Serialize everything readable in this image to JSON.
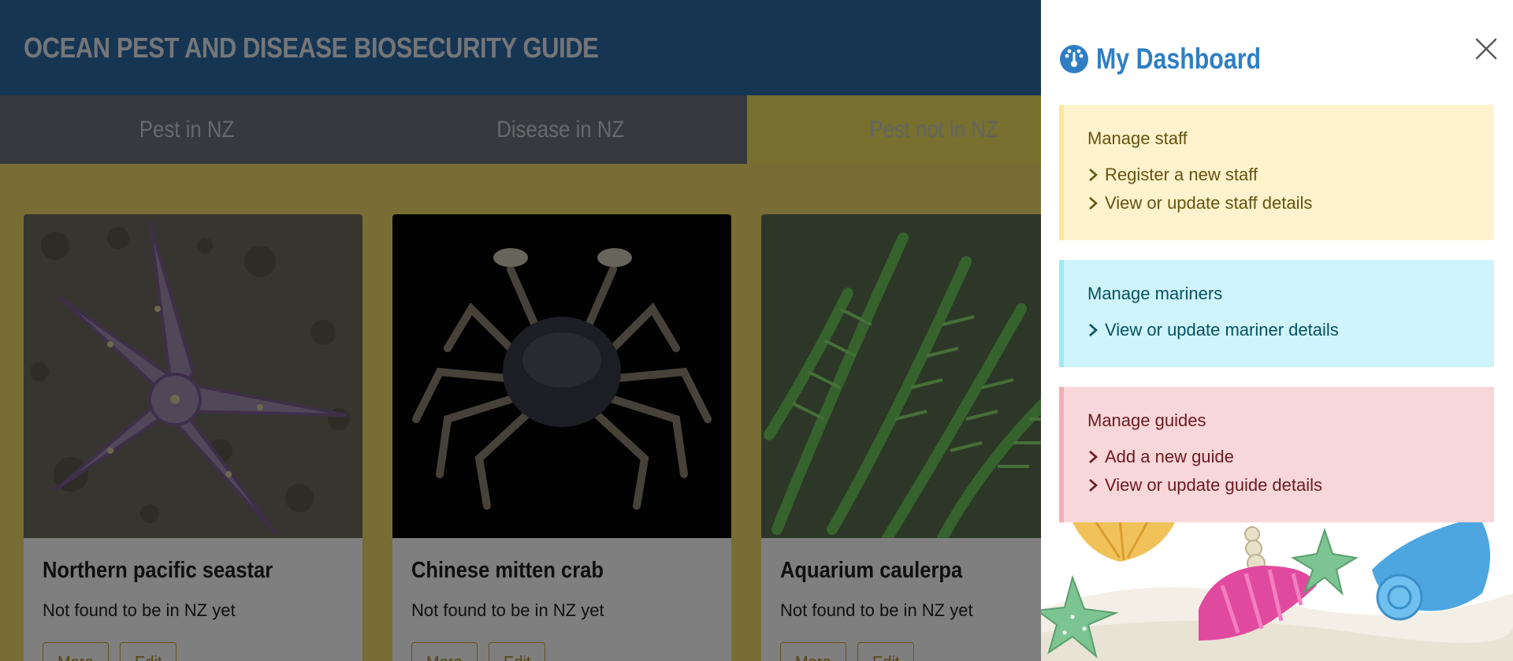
{
  "header": {
    "title": "OCEAN PEST AND DISEASE BIOSECURITY GUIDE"
  },
  "tabs": [
    {
      "label": "Pest in NZ"
    },
    {
      "label": "Disease in NZ"
    },
    {
      "label": "Pest not in NZ"
    }
  ],
  "cards": [
    {
      "title": "Northern pacific seastar",
      "status": "Not found to be in NZ yet",
      "more_label": "More",
      "edit_label": "Edit",
      "image_icon": "starfish-photo"
    },
    {
      "title": "Chinese mitten crab",
      "status": "Not found to be in NZ yet",
      "more_label": "More",
      "edit_label": "Edit",
      "image_icon": "crab-photo"
    },
    {
      "title": "Aquarium caulerpa",
      "status": "Not found to be in NZ yet",
      "more_label": "More",
      "edit_label": "Edit",
      "image_icon": "seaweed-photo"
    }
  ],
  "dashboard": {
    "title": "My Dashboard",
    "icon": "dashboard-gauge-icon",
    "close_icon": "close-icon",
    "sections": {
      "staff": {
        "title": "Manage staff",
        "links": [
          "Register a new staff",
          "View or update staff details"
        ]
      },
      "mariners": {
        "title": "Manage mariners",
        "links": [
          "View or update mariner details"
        ]
      },
      "guides": {
        "title": "Manage guides",
        "links": [
          "Add a new guide",
          "View or update guide details"
        ]
      }
    }
  },
  "colors": {
    "header": "#2d6ba6",
    "accent": "#2f7ec4",
    "active_tab": "#efe05e",
    "staff_bg": "#fff3cd",
    "mariner_bg": "#cff4fc",
    "guide_bg": "#f8d7da"
  }
}
